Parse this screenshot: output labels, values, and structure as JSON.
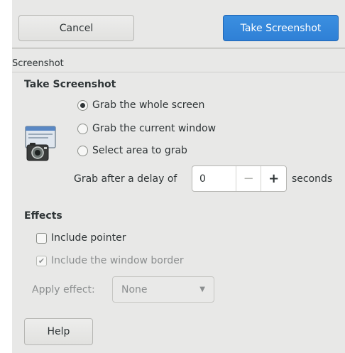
{
  "header": {
    "cancel_label": "Cancel",
    "take_label": "Take Screenshot",
    "accent_color": "#3584e4"
  },
  "breadcrumb": "Screenshot",
  "take_section": {
    "title": "Take Screenshot",
    "options": [
      {
        "label": "Grab the whole screen",
        "selected": true
      },
      {
        "label": "Grab the current window",
        "selected": false
      },
      {
        "label": "Select area to grab",
        "selected": false
      }
    ],
    "delay_label": "Grab after a delay of",
    "delay_value": "0",
    "delay_unit": "seconds",
    "icon": "screenshot-camera-icon"
  },
  "effects_section": {
    "title": "Effects",
    "include_pointer": {
      "label": "Include pointer",
      "checked": false
    },
    "include_border": {
      "label": "Include the window border",
      "checked": true,
      "disabled": true
    },
    "apply_effect_label": "Apply effect:",
    "apply_effect_value": "None"
  },
  "help_label": "Help"
}
